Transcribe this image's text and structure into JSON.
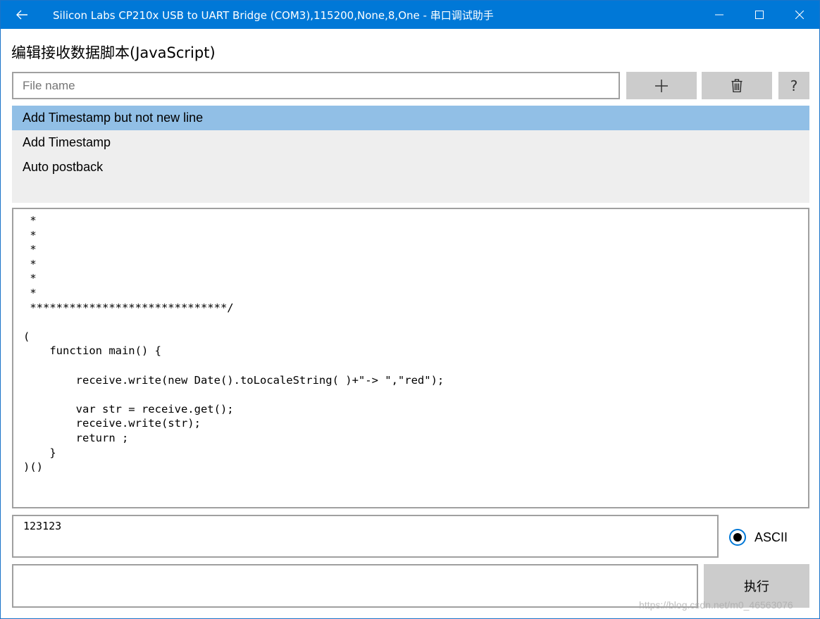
{
  "titlebar": {
    "title": "Silicon Labs CP210x USB to UART Bridge (COM3),115200,None,8,One - 串口调试助手",
    "back_icon": "arrow-left-icon",
    "minimize_icon": "minimize-icon",
    "maximize_icon": "maximize-icon",
    "close_icon": "close-icon",
    "bg_color": "#0078d7"
  },
  "page": {
    "title": "编辑接收数据脚本(JavaScript)"
  },
  "toolbar": {
    "file_name_placeholder": "File name",
    "file_name_value": "",
    "add_icon": "plus-icon",
    "delete_icon": "trash-icon",
    "help_label": "?"
  },
  "script_list": {
    "items": [
      {
        "label": "Add Timestamp but not new line",
        "selected": true
      },
      {
        "label": "Add Timestamp",
        "selected": false
      },
      {
        "label": "Auto postback",
        "selected": false
      }
    ],
    "selected_color": "#91bfe6"
  },
  "editor": {
    "code": " *\n *\n *\n *\n *\n *\n ******************************/\n\n(\n    function main() {\n\n        receive.write(new Date().toLocaleString( )+\"-> \",\"red\");\n\n        var str = receive.get();\n        receive.write(str);\n        return ;\n    }\n)()"
  },
  "test_input": {
    "value": "123123"
  },
  "encoding": {
    "label": "ASCII",
    "checked": true
  },
  "run": {
    "label": "执行"
  },
  "watermark": "https://blog.csdn.net/m0_46563076"
}
